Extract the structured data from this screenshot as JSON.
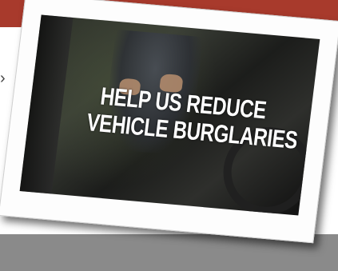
{
  "banner": {
    "line1": "HELP US REDUCE",
    "line2": "VEHICLE BURGLARIES"
  },
  "colors": {
    "top_bar": "#a83a2c",
    "bottom_bar": "#8a8a8a"
  },
  "icons": {
    "left_mark": "arrow-mark-icon"
  }
}
